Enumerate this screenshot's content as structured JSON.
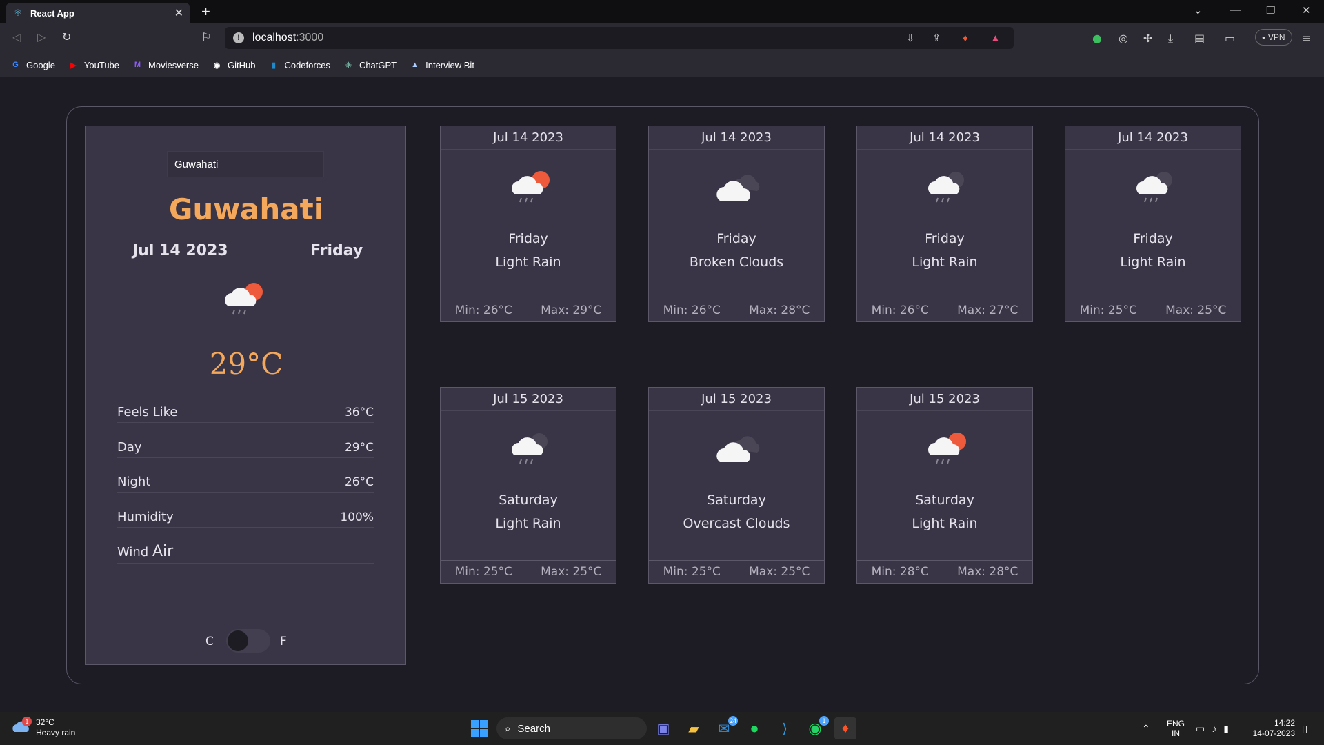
{
  "browser": {
    "tab_title": "React App",
    "url_host": "localhost",
    "url_port": ":3000",
    "vpn_label": "VPN",
    "bookmarks": [
      {
        "label": "Google",
        "icon": "google-icon",
        "color": "#4285f4",
        "glyph": "G"
      },
      {
        "label": "YouTube",
        "icon": "youtube-icon",
        "color": "#ff0000",
        "glyph": "▶"
      },
      {
        "label": "Moviesverse",
        "icon": "moviesverse-icon",
        "color": "#8a5cf5",
        "glyph": "M"
      },
      {
        "label": "GitHub",
        "icon": "github-icon",
        "color": "#ffffff",
        "glyph": "◉"
      },
      {
        "label": "Codeforces",
        "icon": "codeforces-icon",
        "color": "#1f8acb",
        "glyph": "▮"
      },
      {
        "label": "ChatGPT",
        "icon": "chatgpt-icon",
        "color": "#74aa9c",
        "glyph": "✳"
      },
      {
        "label": "Interview Bit",
        "icon": "interviewbit-icon",
        "color": "#aaccff",
        "glyph": "▲"
      }
    ]
  },
  "current": {
    "search_value": "Guwahati",
    "city": "Guwahati",
    "date": "Jul 14 2023",
    "day": "Friday",
    "temp": "29°C",
    "icon": "light-rain-icon",
    "stats": [
      {
        "label": "Feels Like",
        "value": "36°C"
      },
      {
        "label": "Day",
        "value": "29°C"
      },
      {
        "label": "Night",
        "value": "26°C"
      },
      {
        "label": "Humidity",
        "value": "100%"
      }
    ],
    "wind_label": "Wind",
    "wind_value": "Air",
    "unit_c": "C",
    "unit_f": "F"
  },
  "forecast": [
    {
      "date": "Jul 14 2023",
      "day": "Friday",
      "desc": "Light Rain",
      "min": "Min: 26°C",
      "max": "Max: 29°C",
      "icon": "light-rain-sun-icon"
    },
    {
      "date": "Jul 14 2023",
      "day": "Friday",
      "desc": "Broken Clouds",
      "min": "Min: 26°C",
      "max": "Max: 28°C",
      "icon": "broken-clouds-icon"
    },
    {
      "date": "Jul 14 2023",
      "day": "Friday",
      "desc": "Light Rain",
      "min": "Min: 26°C",
      "max": "Max: 27°C",
      "icon": "light-rain-moon-icon"
    },
    {
      "date": "Jul 14 2023",
      "day": "Friday",
      "desc": "Light Rain",
      "min": "Min: 25°C",
      "max": "Max: 25°C",
      "icon": "light-rain-moon-icon"
    },
    {
      "date": "Jul 15 2023",
      "day": "Saturday",
      "desc": "Light Rain",
      "min": "Min: 25°C",
      "max": "Max: 25°C",
      "icon": "light-rain-moon-icon"
    },
    {
      "date": "Jul 15 2023",
      "day": "Saturday",
      "desc": "Overcast Clouds",
      "min": "Min: 25°C",
      "max": "Max: 25°C",
      "icon": "overcast-clouds-icon"
    },
    {
      "date": "Jul 15 2023",
      "day": "Saturday",
      "desc": "Light Rain",
      "min": "Min: 28°C",
      "max": "Max: 28°C",
      "icon": "light-rain-sun-icon"
    }
  ],
  "taskbar": {
    "weather_temp": "32°C",
    "weather_desc": "Heavy rain",
    "weather_badge": "1",
    "search_label": "Search",
    "mail_badge": "24",
    "whatsapp_badge": "1",
    "lang_line1": "ENG",
    "lang_line2": "IN",
    "time": "14:22",
    "date": "14-07-2023"
  },
  "colors": {
    "accent": "#f4a85c",
    "panel": "#3a3546",
    "background": "#1d1b24"
  }
}
